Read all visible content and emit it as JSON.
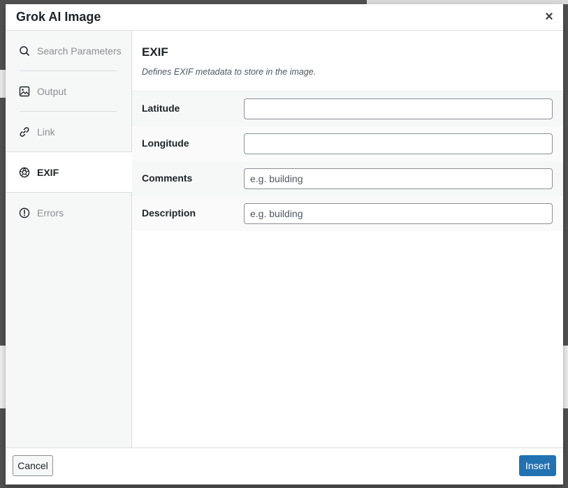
{
  "dialog": {
    "title": "Grok AI Image",
    "close_glyph": "×"
  },
  "sidebar": {
    "items": [
      {
        "label": "Search Parameters",
        "icon": "search-icon",
        "active": false
      },
      {
        "label": "Output",
        "icon": "image-icon",
        "active": false
      },
      {
        "label": "Link",
        "icon": "link-icon",
        "active": false
      },
      {
        "label": "EXIF",
        "icon": "aperture-icon",
        "active": true
      },
      {
        "label": "Errors",
        "icon": "alert-circle-icon",
        "active": false
      }
    ]
  },
  "section": {
    "title": "EXIF",
    "description": "Defines EXIF metadata to store in the image."
  },
  "fields": [
    {
      "label": "Latitude",
      "value": "",
      "placeholder": ""
    },
    {
      "label": "Longitude",
      "value": "",
      "placeholder": ""
    },
    {
      "label": "Comments",
      "value": "",
      "placeholder": "e.g. building"
    },
    {
      "label": "Description",
      "value": "",
      "placeholder": "e.g. building"
    }
  ],
  "footer": {
    "cancel_label": "Cancel",
    "insert_label": "Insert"
  },
  "colors": {
    "primary": "#2271b1",
    "sidebar_bg": "#f6f7f7",
    "text": "#1d2327",
    "muted_text": "#8c8f94"
  }
}
